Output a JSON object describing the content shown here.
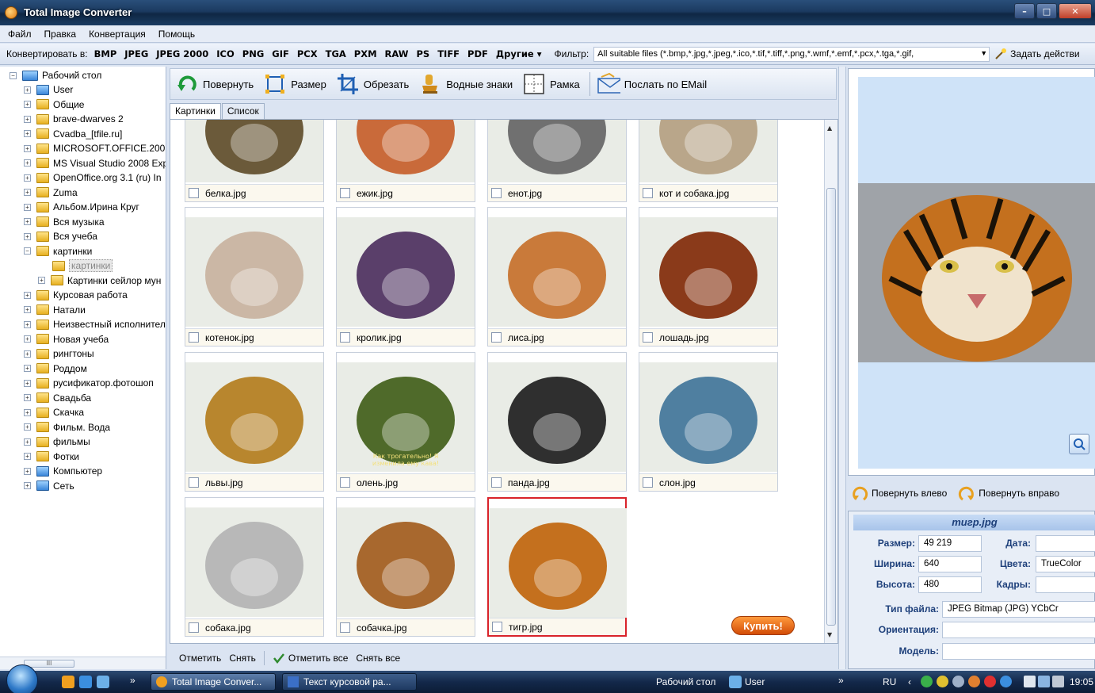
{
  "window": {
    "title": "Total Image Converter",
    "buttons": [
      "–",
      "□",
      "✕"
    ]
  },
  "menu": [
    "Файл",
    "Правка",
    "Конвертация",
    "Помощь"
  ],
  "formatbar": {
    "label": "Конвертировать в:",
    "formats": [
      "BMP",
      "JPEG",
      "JPEG 2000",
      "ICO",
      "PNG",
      "GIF",
      "PCX",
      "TGA",
      "PXM",
      "RAW",
      "PS",
      "TIFF",
      "PDF",
      "Другие ▾"
    ],
    "filter_label": "Фильтр:",
    "filter_value": "All suitable files (*.bmp,*.jpg,*.jpeg,*.ico,*.tif,*.tiff,*.png,*.wmf,*.emf,*.pcx,*.tga,*.gif,",
    "task_label": "Задать действи"
  },
  "tree": {
    "root": "Рабочий стол",
    "items": [
      {
        "label": "User",
        "type": "special"
      },
      {
        "label": "Общие",
        "type": "folder"
      },
      {
        "label": "brave-dwarves 2",
        "type": "folder"
      },
      {
        "label": "Cvadba_[tfile.ru]",
        "type": "folder"
      },
      {
        "label": "MICROSOFT.OFFICE.2003",
        "type": "folder"
      },
      {
        "label": "MS Visual Studio 2008 Expr",
        "type": "folder"
      },
      {
        "label": "OpenOffice.org 3.1 (ru) In",
        "type": "folder"
      },
      {
        "label": "Zuma",
        "type": "folder"
      },
      {
        "label": "Альбом.Ирина Круг",
        "type": "folder"
      },
      {
        "label": "Вся музыка",
        "type": "folder"
      },
      {
        "label": "Вся учеба",
        "type": "folder"
      },
      {
        "label": "картинки",
        "type": "folder"
      },
      {
        "label": "картинки",
        "type": "folder-sub-selected"
      },
      {
        "label": "Картинки сейлор мун",
        "type": "folder-sub"
      },
      {
        "label": "Курсовая работа",
        "type": "folder"
      },
      {
        "label": "Натали",
        "type": "folder"
      },
      {
        "label": "Неизвестный исполнител",
        "type": "folder"
      },
      {
        "label": "Новая учеба",
        "type": "folder"
      },
      {
        "label": "рингтоны",
        "type": "folder"
      },
      {
        "label": "Роддом",
        "type": "folder"
      },
      {
        "label": "русификатор.фотошоп",
        "type": "folder"
      },
      {
        "label": "Свадьба",
        "type": "folder"
      },
      {
        "label": "Скачка",
        "type": "folder"
      },
      {
        "label": "Фильм. Вода",
        "type": "folder"
      },
      {
        "label": "фильмы",
        "type": "folder"
      },
      {
        "label": "Фотки",
        "type": "folder"
      },
      {
        "label": "Компьютер",
        "type": "special"
      },
      {
        "label": "Сеть",
        "type": "special"
      }
    ],
    "scroll_thumb": "III"
  },
  "toolbar": {
    "rotate": "Повернуть",
    "resize": "Размер",
    "crop": "Обрезать",
    "watermark": "Водные знаки",
    "frame": "Рамка",
    "email": "Послать по EMail"
  },
  "tabs": [
    "Картинки",
    "Список"
  ],
  "thumbnails": [
    {
      "name": "белка.jpg",
      "icon": "squirrel-photo",
      "color": "#6b5a3a"
    },
    {
      "name": "ежик.jpg",
      "icon": "hedgehog-photo",
      "color": "#c96a3a"
    },
    {
      "name": "енот.jpg",
      "icon": "raccoon-photo",
      "color": "#707070"
    },
    {
      "name": "кот и собака.jpg",
      "icon": "cat-dog-photo",
      "color": "#b9a68a"
    },
    {
      "name": "котенок.jpg",
      "icon": "kitten-photo",
      "color": "#cbb7a5"
    },
    {
      "name": "кролик.jpg",
      "icon": "rabbit-photo",
      "color": "#5a3f6a"
    },
    {
      "name": "лиса.jpg",
      "icon": "fox-photo",
      "color": "#c97a3a"
    },
    {
      "name": "лошадь.jpg",
      "icon": "horse-photo",
      "color": "#8a3a1a"
    },
    {
      "name": "львы.jpg",
      "icon": "lions-photo",
      "color": "#b8862e"
    },
    {
      "name": "олень.jpg",
      "icon": "deer-photo",
      "color": "#4f6a2a"
    },
    {
      "name": "панда.jpg",
      "icon": "panda-photo",
      "color": "#2f2f2f"
    },
    {
      "name": "слон.jpg",
      "icon": "elephant-photo",
      "color": "#4f7fa0"
    },
    {
      "name": "собака.jpg",
      "icon": "husky-photo",
      "color": "#b8b8b8"
    },
    {
      "name": "собачка.jpg",
      "icon": "puppy-photo",
      "color": "#a8682e"
    },
    {
      "name": "тигр.jpg",
      "icon": "tiger-photo",
      "color": "#c4701e",
      "selected": true
    }
  ],
  "deer_caption": "Как трогательно! Я изменила ему кава!",
  "buy_label": "Купить!",
  "actions": {
    "mark": "Отметить",
    "unmark": "Снять",
    "mark_all": "Отметить все",
    "unmark_all": "Снять все"
  },
  "preview": {
    "rotate_left": "Повернуть влево",
    "rotate_right": "Повернуть вправо"
  },
  "info": {
    "filename": "тигр.jpg",
    "size_label": "Размер:",
    "size": "49 219",
    "date_label": "Дата:",
    "date": "",
    "width_label": "Ширина:",
    "width": "640",
    "colors_label": "Цвета:",
    "colors": "TrueColor",
    "height_label": "Высота:",
    "height": "480",
    "frames_label": "Кадры:",
    "frames": "",
    "filetype_label": "Тип файла:",
    "filetype": "JPEG Bitmap (JPG) YCbCr",
    "orientation_label": "Ориентация:",
    "orientation": "",
    "model_label": "Модель:",
    "model": ""
  },
  "taskbar": {
    "tasks": [
      "Total Image Conver...",
      "Текст курсовой ра..."
    ],
    "desktop": "Рабочий стол",
    "user": "User",
    "lang": "RU",
    "time": "19:05",
    "chevron": "»"
  }
}
